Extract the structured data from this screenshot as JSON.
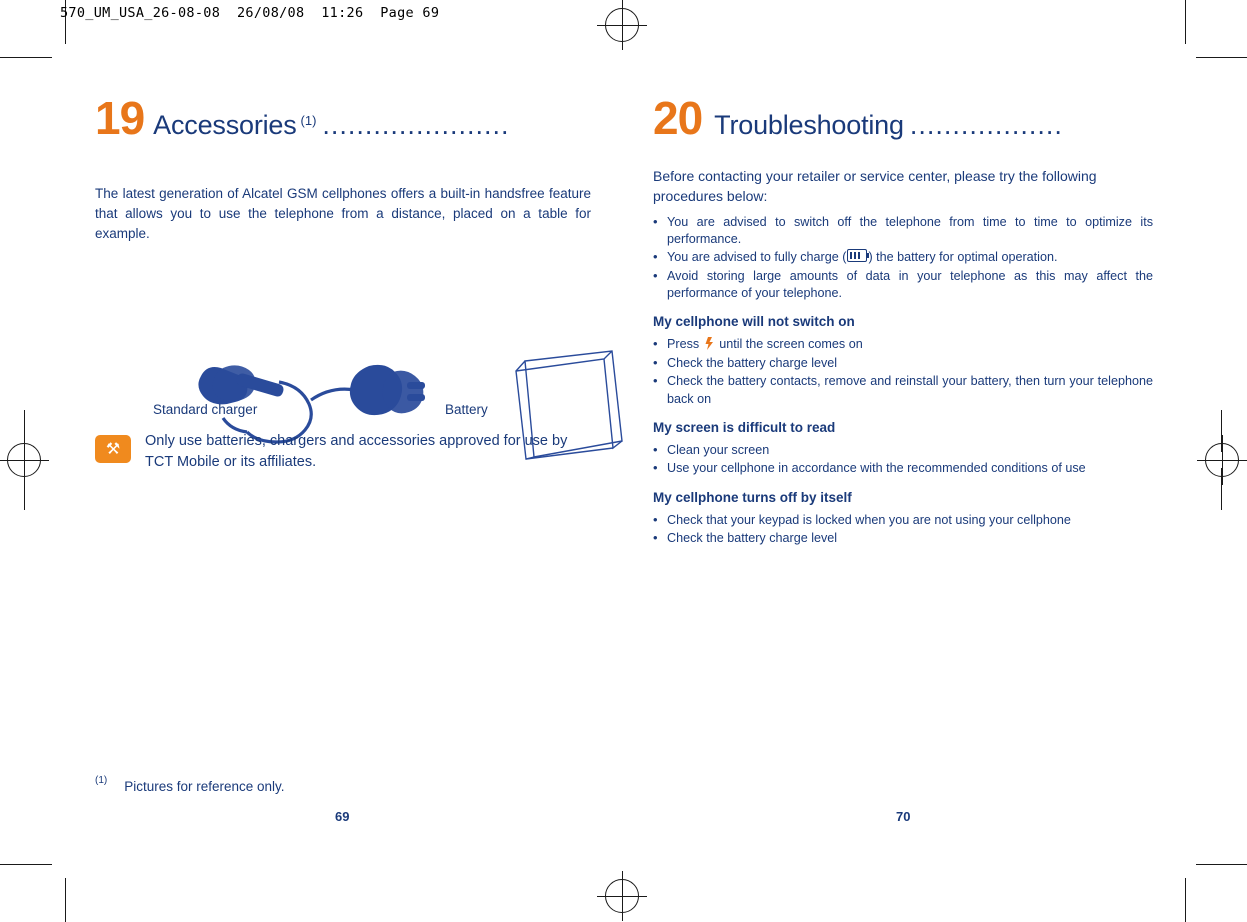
{
  "print_stamp": "570_UM_USA_26-08-08  26/08/08  11:26  Page 69",
  "colors": {
    "ink_blue": "#1a3a7a",
    "accent_orange": "#e8761a",
    "note_icon_bg": "#f08a1e"
  },
  "left_page": {
    "chapter_number": "19",
    "chapter_title": "Accessories",
    "chapter_superscript": "(1)",
    "chapter_dots": "......................",
    "intro_paragraph": "The latest generation of Alcatel GSM cellphones offers a built-in handsfree feature that allows you to use the telephone from a distance, placed on a table for example.",
    "figures": [
      {
        "caption": "Standard charger",
        "icon": "charger-illustration"
      },
      {
        "caption": "Battery",
        "icon": "battery-illustration"
      }
    ],
    "note": {
      "icon": "warning-note-icon",
      "text": "Only use batteries, chargers and accessories approved for use by TCT Mobile or its affiliates."
    },
    "footnote": {
      "mark": "(1)",
      "text": "Pictures for reference only."
    },
    "folio": "69"
  },
  "right_page": {
    "chapter_number": "20",
    "chapter_title": "Troubleshooting",
    "chapter_dots": "..................",
    "intro_paragraph": "Before contacting your retailer or service center, please try the following procedures below:",
    "intro_bullets": [
      "You are advised to switch off the telephone from time to time to optimize its performance.",
      "You are advised to fully charge ( ) the battery for optimal operation.",
      "Avoid storing large amounts of data in your telephone as this may affect the performance of your telephone."
    ],
    "sections": [
      {
        "heading": "My cellphone will not switch on",
        "bullets": [
          "Press   until the screen comes on",
          "Check the battery charge level",
          "Check the battery contacts, remove and reinstall your battery, then turn your telephone back on"
        ]
      },
      {
        "heading": "My screen is difficult to read",
        "bullets": [
          "Clean your screen",
          "Use your cellphone in accordance with the recommended conditions of use"
        ]
      },
      {
        "heading": "My cellphone turns off by itself",
        "bullets": [
          "Check that your keypad is locked when you are not using your cellphone",
          "Check the battery charge level"
        ]
      }
    ],
    "folio": "70"
  }
}
